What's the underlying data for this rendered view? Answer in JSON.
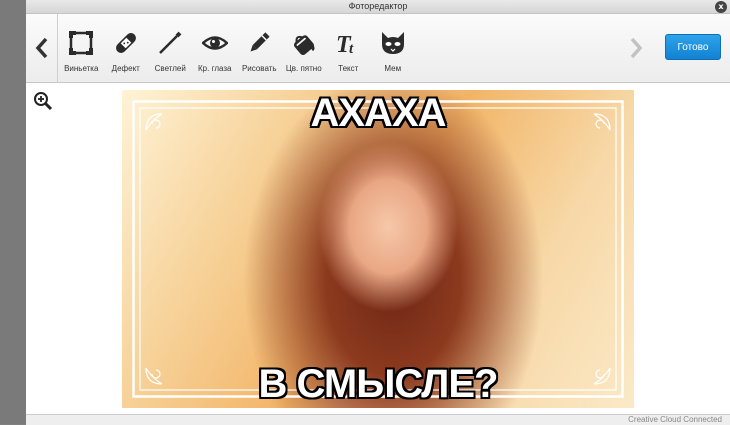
{
  "window": {
    "title": "Фоторедактор",
    "close_label": "x"
  },
  "toolbar": {
    "tools": [
      {
        "label": "Виньетка",
        "icon": "vignette-icon"
      },
      {
        "label": "Дефект",
        "icon": "bandage-icon"
      },
      {
        "label": "Светлей",
        "icon": "brightness-wand-icon"
      },
      {
        "label": "Кр. глаза",
        "icon": "eye-icon"
      },
      {
        "label": "Рисовать",
        "icon": "pencil-icon"
      },
      {
        "label": "Цв. пятно",
        "icon": "paint-bucket-icon"
      },
      {
        "label": "Текст",
        "icon": "text-icon"
      },
      {
        "label": "Мем",
        "icon": "cat-mask-icon"
      }
    ],
    "done_label": "Готово"
  },
  "meme": {
    "top_text": "АХАХА",
    "bottom_text": "В СМЫСЛЕ?"
  },
  "status": {
    "text": "Creative Cloud Connected"
  },
  "colors": {
    "accent": "#1a8fdf",
    "icon": "#2b2b2b"
  }
}
